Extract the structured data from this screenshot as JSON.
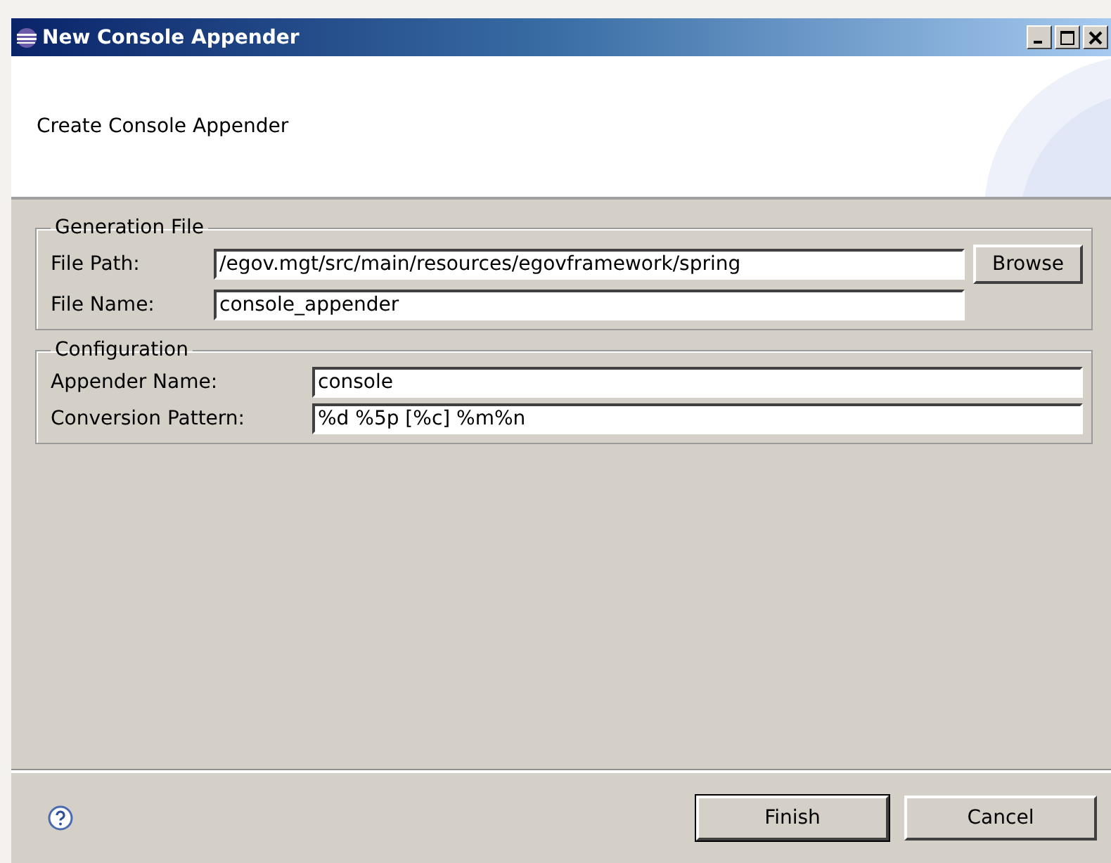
{
  "window": {
    "title": "New Console Appender"
  },
  "banner": {
    "text": "Create Console Appender"
  },
  "groups": [
    {
      "title": "Generation File",
      "fields": [
        {
          "label": "File Path:",
          "value": "/egov.mgt/src/main/resources/egovframework/spring",
          "button": "Browse"
        },
        {
          "label": "File Name:",
          "value": "console_appender"
        }
      ]
    },
    {
      "title": "Configuration",
      "fields": [
        {
          "label": "Appender Name:",
          "value": "console"
        },
        {
          "label": "Conversion Pattern:",
          "value": "%d %5p [%c] %m%n"
        }
      ]
    }
  ],
  "buttons": [
    {
      "label": "Finish",
      "default": true
    },
    {
      "label": "Cancel",
      "default": false
    }
  ]
}
